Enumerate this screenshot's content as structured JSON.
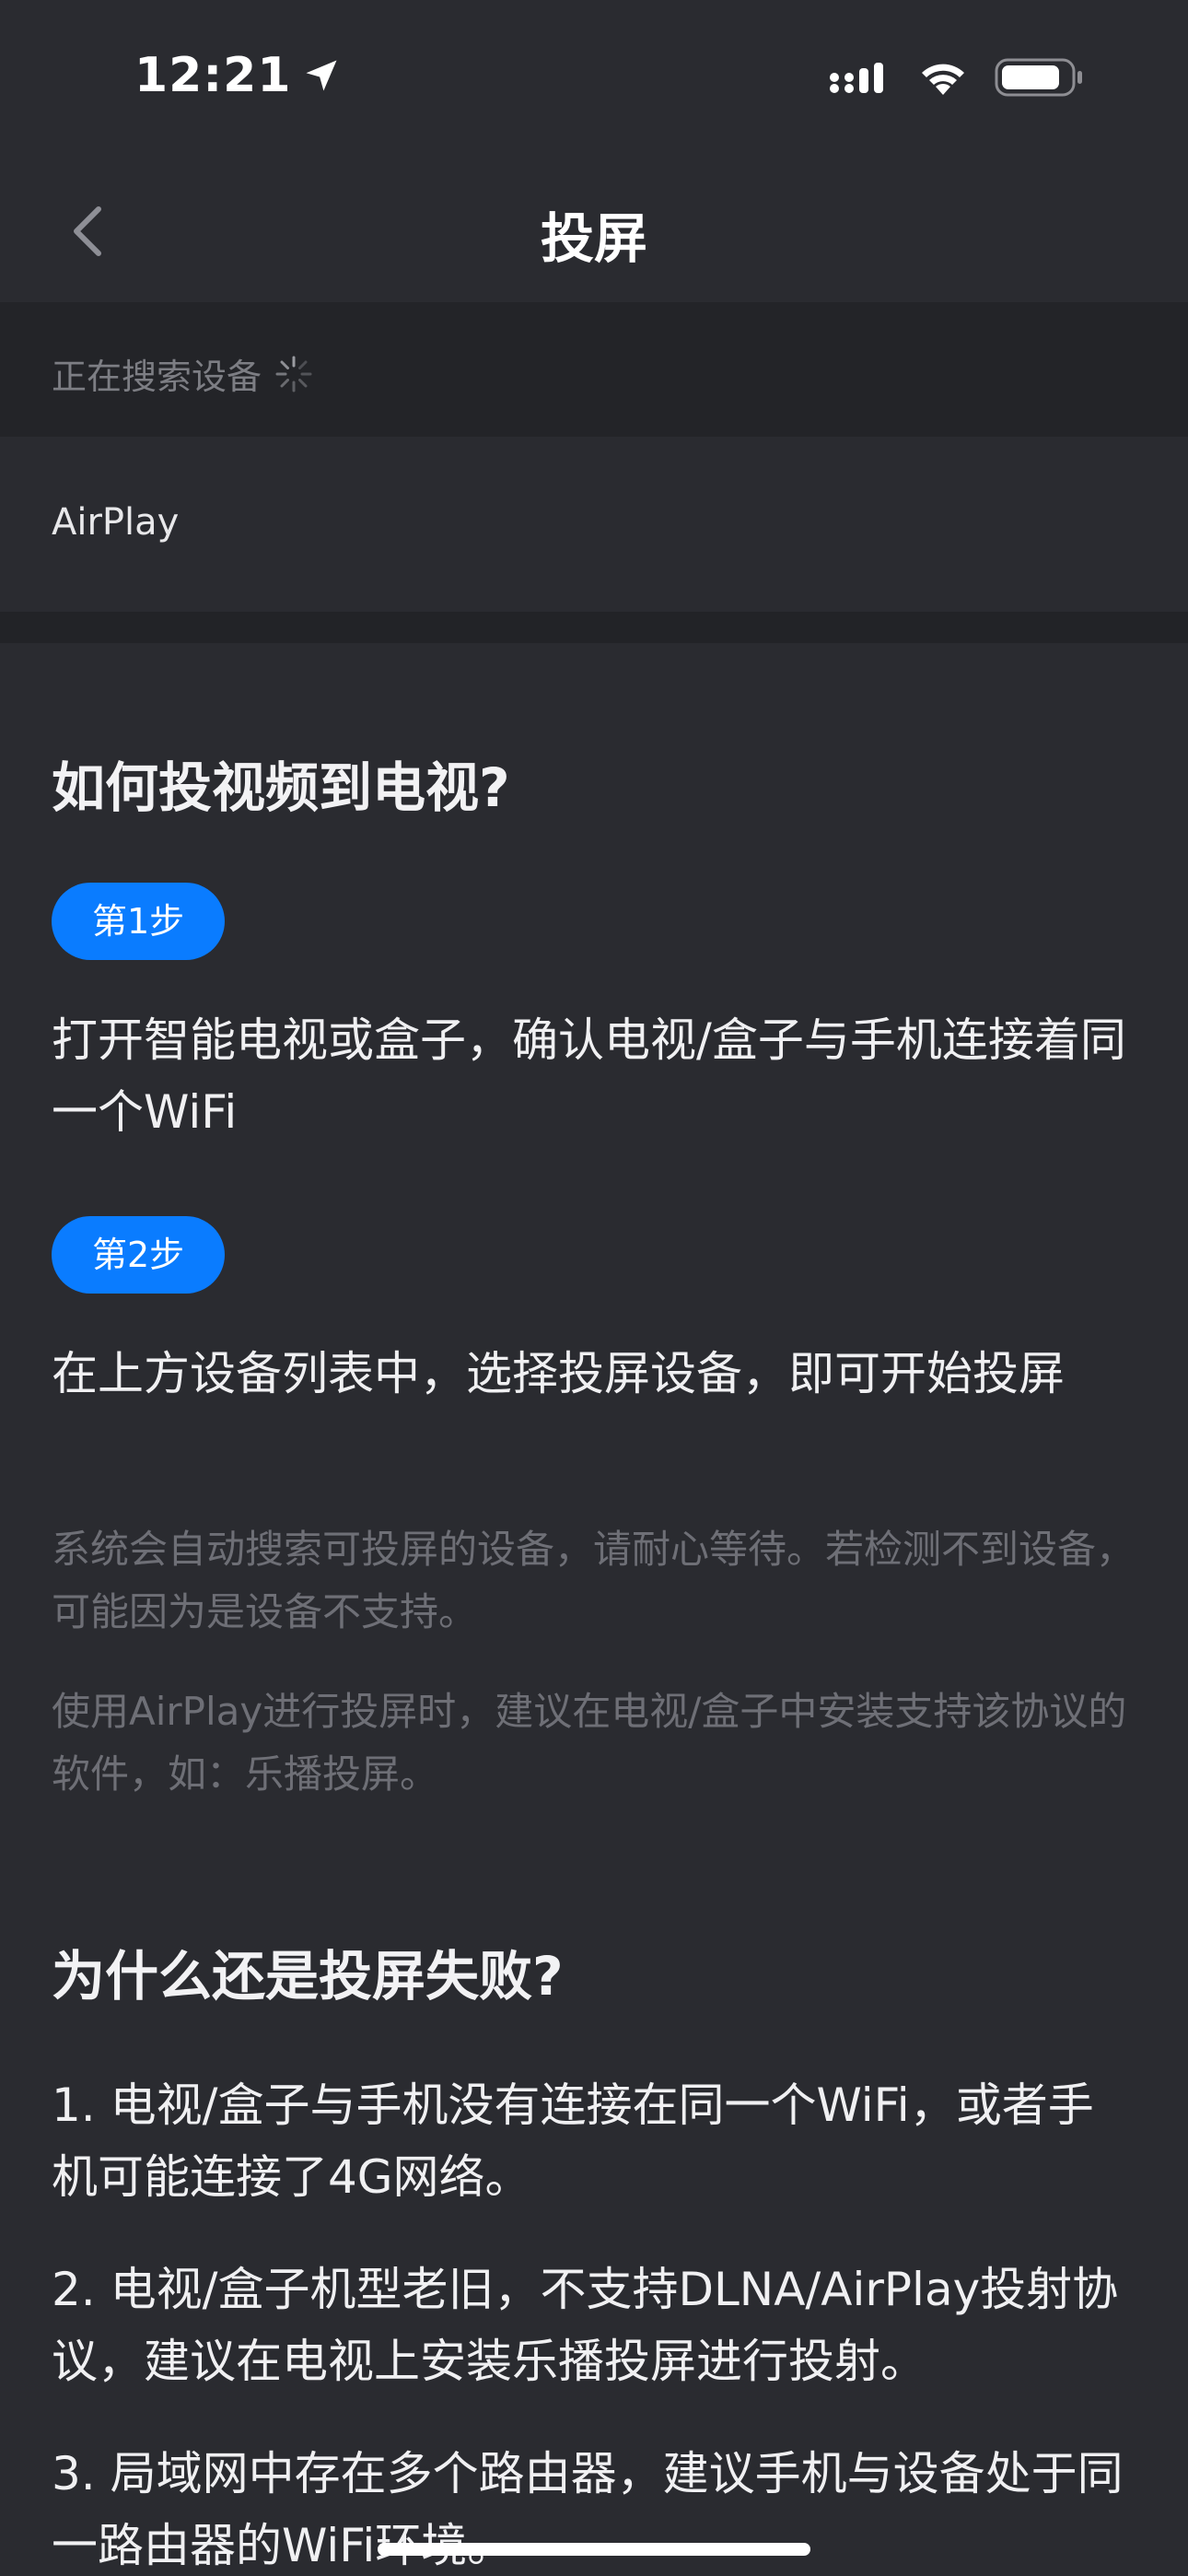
{
  "status_bar": {
    "time": "12:21"
  },
  "nav": {
    "title": "投屏"
  },
  "search": {
    "label": "正在搜索设备"
  },
  "devices": [
    {
      "name": "AirPlay"
    }
  ],
  "help": {
    "title1": "如何投视频到电视?",
    "step1_label": "第1步",
    "step1_text": "打开智能电视或盒子，确认电视/盒子与手机连接着同一个WiFi",
    "step2_label": "第2步",
    "step2_text": "在上方设备列表中，选择投屏设备，即可开始投屏",
    "note1": "系统会自动搜索可投屏的设备，请耐心等待。若检测不到设备，可能因为是设备不支持。",
    "note2": "使用AirPlay进行投屏时，建议在电视/盒子中安装支持该协议的软件，如：乐播投屏。",
    "title2": "为什么还是投屏失败?",
    "reason1": "1. 电视/盒子与手机没有连接在同一个WiFi，或者手机可能连接了4G网络。",
    "reason2": "2. 电视/盒子机型老旧，不支持DLNA/AirPlay投射协议，建议在电视上安装乐播投屏进行投射。",
    "reason3": "3. 局域网中存在多个路由器，建议手机与设备处于同一路由器的WiFi环境。"
  },
  "colors": {
    "accent": "#0a7cff",
    "background": "#2a2b30",
    "section_bg": "#232428"
  }
}
